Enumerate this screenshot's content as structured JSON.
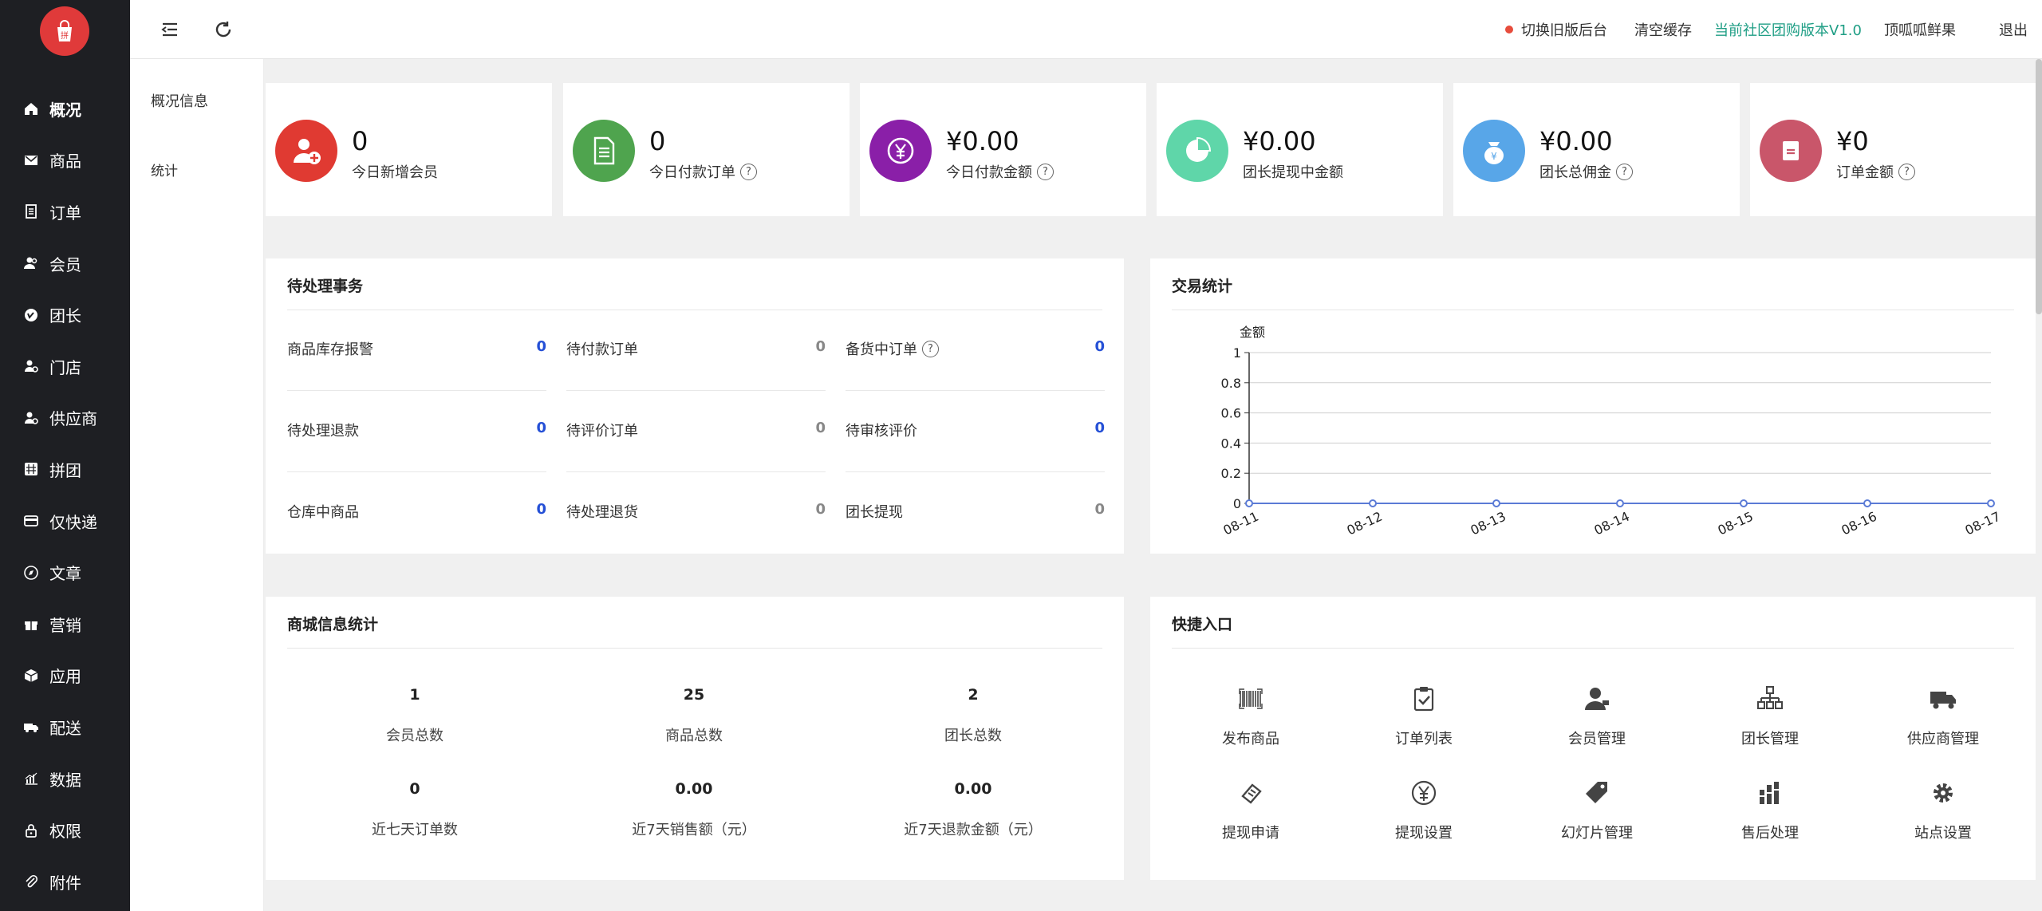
{
  "sidebar": {
    "items": [
      {
        "label": "概况",
        "icon": "home-icon"
      },
      {
        "label": "商品",
        "icon": "mail-icon"
      },
      {
        "label": "订单",
        "icon": "document-icon"
      },
      {
        "label": "会员",
        "icon": "users-icon"
      },
      {
        "label": "团长",
        "icon": "vimeo-icon"
      },
      {
        "label": "门店",
        "icon": "store-user-icon"
      },
      {
        "label": "供应商",
        "icon": "supplier-icon"
      },
      {
        "label": "拼团",
        "icon": "grid-icon"
      },
      {
        "label": "仅快递",
        "icon": "card-icon"
      },
      {
        "label": "文章",
        "icon": "compass-icon"
      },
      {
        "label": "营销",
        "icon": "gift-icon"
      },
      {
        "label": "应用",
        "icon": "cube-icon"
      },
      {
        "label": "配送",
        "icon": "truck-icon"
      },
      {
        "label": "数据",
        "icon": "bar-chart-icon"
      },
      {
        "label": "权限",
        "icon": "lock-icon"
      },
      {
        "label": "附件",
        "icon": "paperclip-icon"
      }
    ]
  },
  "subnav": {
    "overview": "概况信息",
    "stats": "统计"
  },
  "topbar": {
    "switch_label": "切换旧版后台",
    "clear_cache": "清空缓存",
    "version": "当前社区团购版本V1.0",
    "username": "顶呱呱鲜果",
    "logout": "退出"
  },
  "cards": [
    {
      "value": "0",
      "label": "今日新增会员",
      "help": false,
      "color": "#e03a32"
    },
    {
      "value": "0",
      "label": "今日付款订单",
      "help": true,
      "color": "#4fa44e"
    },
    {
      "value": "¥0.00",
      "label": "今日付款金额",
      "help": true,
      "color": "#8a1fa8"
    },
    {
      "value": "¥0.00",
      "label": "团长提现中金额",
      "help": false,
      "color": "#5fd6a9"
    },
    {
      "value": "¥0.00",
      "label": "团长总佣金",
      "help": true,
      "color": "#58a6e8"
    },
    {
      "value": "¥0",
      "label": "订单金额",
      "help": true,
      "color": "#c9566a"
    }
  ],
  "todo": {
    "title": "待处理事务",
    "items": [
      {
        "label": "商品库存报警",
        "value": "0",
        "color": "#2550d6",
        "help": false
      },
      {
        "label": "待付款订单",
        "value": "0",
        "color": "#888888",
        "help": false
      },
      {
        "label": "备货中订单",
        "value": "0",
        "color": "#2550d6",
        "help": true
      },
      {
        "label": "待处理退款",
        "value": "0",
        "color": "#2550d6",
        "help": false
      },
      {
        "label": "待评价订单",
        "value": "0",
        "color": "#888888",
        "help": false
      },
      {
        "label": "待审核评价",
        "value": "0",
        "color": "#2550d6",
        "help": false
      },
      {
        "label": "仓库中商品",
        "value": "0",
        "color": "#2550d6",
        "help": false
      },
      {
        "label": "待处理退货",
        "value": "0",
        "color": "#888888",
        "help": false
      },
      {
        "label": "团长提现",
        "value": "0",
        "color": "#888888",
        "help": false
      }
    ]
  },
  "trade": {
    "title": "交易统计"
  },
  "chart_data": {
    "type": "line",
    "ylabel": "金额",
    "x": [
      "08-11",
      "08-12",
      "08-13",
      "08-14",
      "08-15",
      "08-16",
      "08-17"
    ],
    "series": [
      {
        "values": [
          0,
          0,
          0,
          0,
          0,
          0,
          0
        ]
      }
    ],
    "yticks": [
      "0",
      "0.2",
      "0.4",
      "0.6",
      "0.8",
      "1"
    ],
    "ylim": [
      0,
      1
    ],
    "grid": true
  },
  "mall": {
    "title": "商城信息统计",
    "stats": [
      {
        "value": "1",
        "label": "会员总数"
      },
      {
        "value": "25",
        "label": "商品总数"
      },
      {
        "value": "2",
        "label": "团长总数"
      },
      {
        "value": "0",
        "label": "近七天订单数"
      },
      {
        "value": "0.00",
        "label": "近7天销售额（元）"
      },
      {
        "value": "0.00",
        "label": "近7天退款金额（元）"
      }
    ]
  },
  "quick": {
    "title": "快捷入口",
    "items": [
      {
        "label": "发布商品",
        "icon": "barcode-icon"
      },
      {
        "label": "订单列表",
        "icon": "clipboard-check-icon"
      },
      {
        "label": "会员管理",
        "icon": "user-icon"
      },
      {
        "label": "团长管理",
        "icon": "sitemap-icon"
      },
      {
        "label": "供应商管理",
        "icon": "truck-icon"
      },
      {
        "label": "提现申请",
        "icon": "ticket-icon"
      },
      {
        "label": "提现设置",
        "icon": "yen-circle-icon"
      },
      {
        "label": "幻灯片管理",
        "icon": "tag-icon"
      },
      {
        "label": "售后处理",
        "icon": "bars-icon"
      },
      {
        "label": "站点设置",
        "icon": "gear-icon"
      }
    ]
  }
}
